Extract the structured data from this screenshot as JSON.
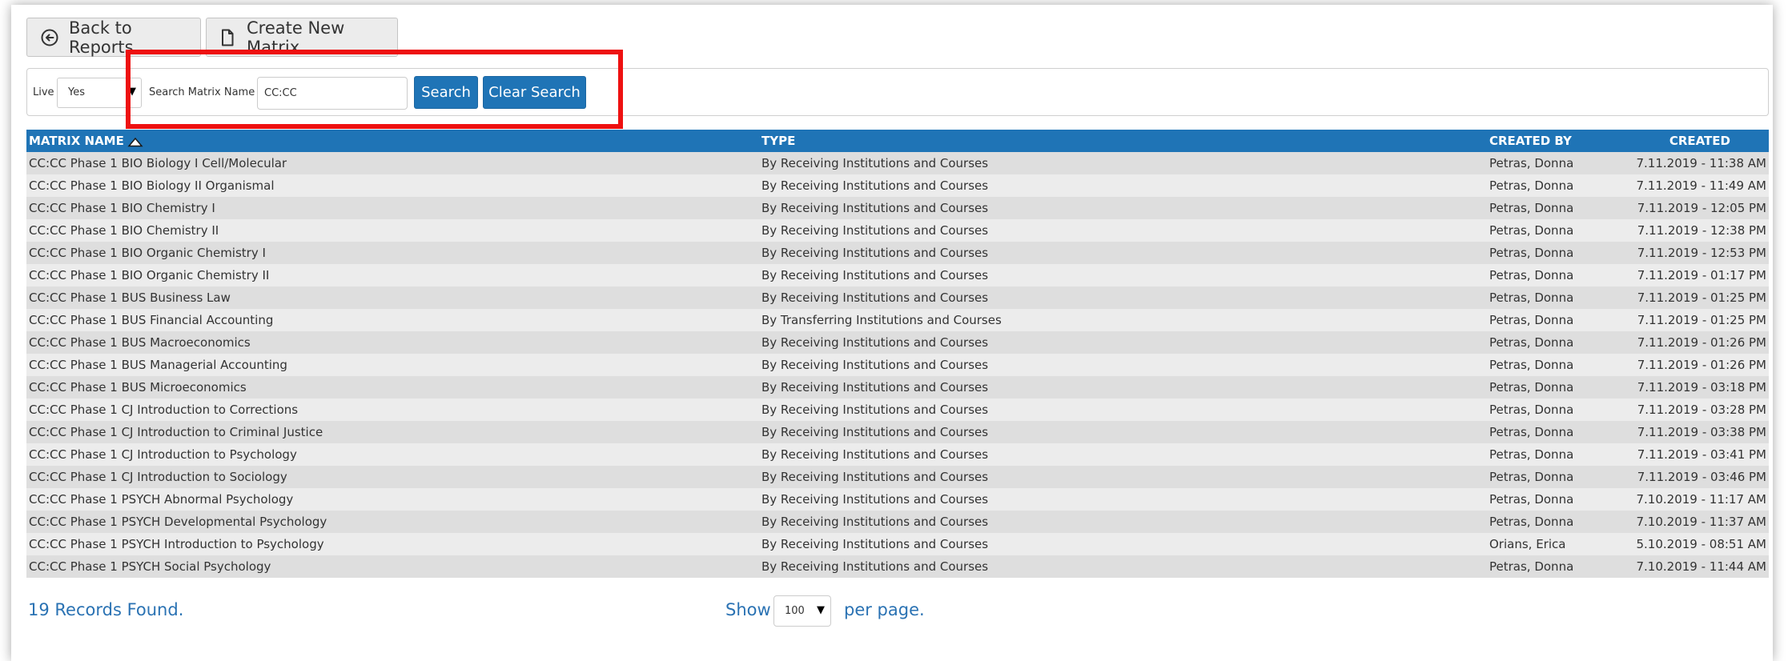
{
  "toolbar": {
    "back_label": "Back to Reports",
    "create_label": "Create New Matrix"
  },
  "search": {
    "live_label": "Live",
    "live_value": "Yes",
    "name_label": "Search Matrix Name",
    "name_value": "CC:CC",
    "search_button": "Search",
    "clear_button": "Clear Search"
  },
  "table": {
    "headers": [
      "MATRIX NAME",
      "TYPE",
      "CREATED BY",
      "CREATED"
    ],
    "rows": [
      [
        "CC:CC Phase 1 BIO Biology I Cell/Molecular",
        "By Receiving Institutions and Courses",
        "Petras, Donna",
        "7.11.2019 - 11:38 AM"
      ],
      [
        "CC:CC Phase 1 BIO Biology II Organismal",
        "By Receiving Institutions and Courses",
        "Petras, Donna",
        "7.11.2019 - 11:49 AM"
      ],
      [
        "CC:CC Phase 1 BIO Chemistry I",
        "By Receiving Institutions and Courses",
        "Petras, Donna",
        "7.11.2019 - 12:05 PM"
      ],
      [
        "CC:CC Phase 1 BIO Chemistry II",
        "By Receiving Institutions and Courses",
        "Petras, Donna",
        "7.11.2019 - 12:38 PM"
      ],
      [
        "CC:CC Phase 1 BIO Organic Chemistry I",
        "By Receiving Institutions and Courses",
        "Petras, Donna",
        "7.11.2019 - 12:53 PM"
      ],
      [
        "CC:CC Phase 1 BIO Organic Chemistry II",
        "By Receiving Institutions and Courses",
        "Petras, Donna",
        "7.11.2019 - 01:17 PM"
      ],
      [
        "CC:CC Phase 1 BUS Business Law",
        "By Receiving Institutions and Courses",
        "Petras, Donna",
        "7.11.2019 - 01:25 PM"
      ],
      [
        "CC:CC Phase 1 BUS Financial Accounting",
        "By Transferring Institutions and Courses",
        "Petras, Donna",
        "7.11.2019 - 01:25 PM"
      ],
      [
        "CC:CC Phase 1 BUS Macroeconomics",
        "By Receiving Institutions and Courses",
        "Petras, Donna",
        "7.11.2019 - 01:26 PM"
      ],
      [
        "CC:CC Phase 1 BUS Managerial Accounting",
        "By Receiving Institutions and Courses",
        "Petras, Donna",
        "7.11.2019 - 01:26 PM"
      ],
      [
        "CC:CC Phase 1 BUS Microeconomics",
        "By Receiving Institutions and Courses",
        "Petras, Donna",
        "7.11.2019 - 03:18 PM"
      ],
      [
        "CC:CC Phase 1 CJ Introduction to Corrections",
        "By Receiving Institutions and Courses",
        "Petras, Donna",
        "7.11.2019 - 03:28 PM"
      ],
      [
        "CC:CC Phase 1 CJ Introduction to Criminal Justice",
        "By Receiving Institutions and Courses",
        "Petras, Donna",
        "7.11.2019 - 03:38 PM"
      ],
      [
        "CC:CC Phase 1 CJ Introduction to Psychology",
        "By Receiving Institutions and Courses",
        "Petras, Donna",
        "7.11.2019 - 03:41 PM"
      ],
      [
        "CC:CC Phase 1 CJ Introduction to Sociology",
        "By Receiving Institutions and Courses",
        "Petras, Donna",
        "7.11.2019 - 03:46 PM"
      ],
      [
        "CC:CC Phase 1 PSYCH Abnormal Psychology",
        "By Receiving Institutions and Courses",
        "Petras, Donna",
        "7.10.2019 - 11:17 AM"
      ],
      [
        "CC:CC Phase 1 PSYCH Developmental Psychology",
        "By Receiving Institutions and Courses",
        "Petras, Donna",
        "7.10.2019 - 11:37 AM"
      ],
      [
        "CC:CC Phase 1 PSYCH Introduction to Psychology",
        "By Receiving Institutions and Courses",
        "Orians, Erica",
        "5.10.2019 - 08:51 AM"
      ],
      [
        "CC:CC Phase 1 PSYCH Social Psychology",
        "By Receiving Institutions and Courses",
        "Petras, Donna",
        "7.10.2019 - 11:44 AM"
      ]
    ]
  },
  "footer": {
    "records_found": "19 Records Found.",
    "show_label": "Show",
    "per_page_value": "100",
    "per_page_label": "per page."
  },
  "colors": {
    "accent": "#1f74b6",
    "highlight": "#ee1111",
    "link": "#2a72b3"
  },
  "icons": {
    "back": "circle-arrow-left-icon",
    "create": "document-icon",
    "sort": "sort-ascending-icon",
    "dropdown": "caret-down-icon"
  }
}
